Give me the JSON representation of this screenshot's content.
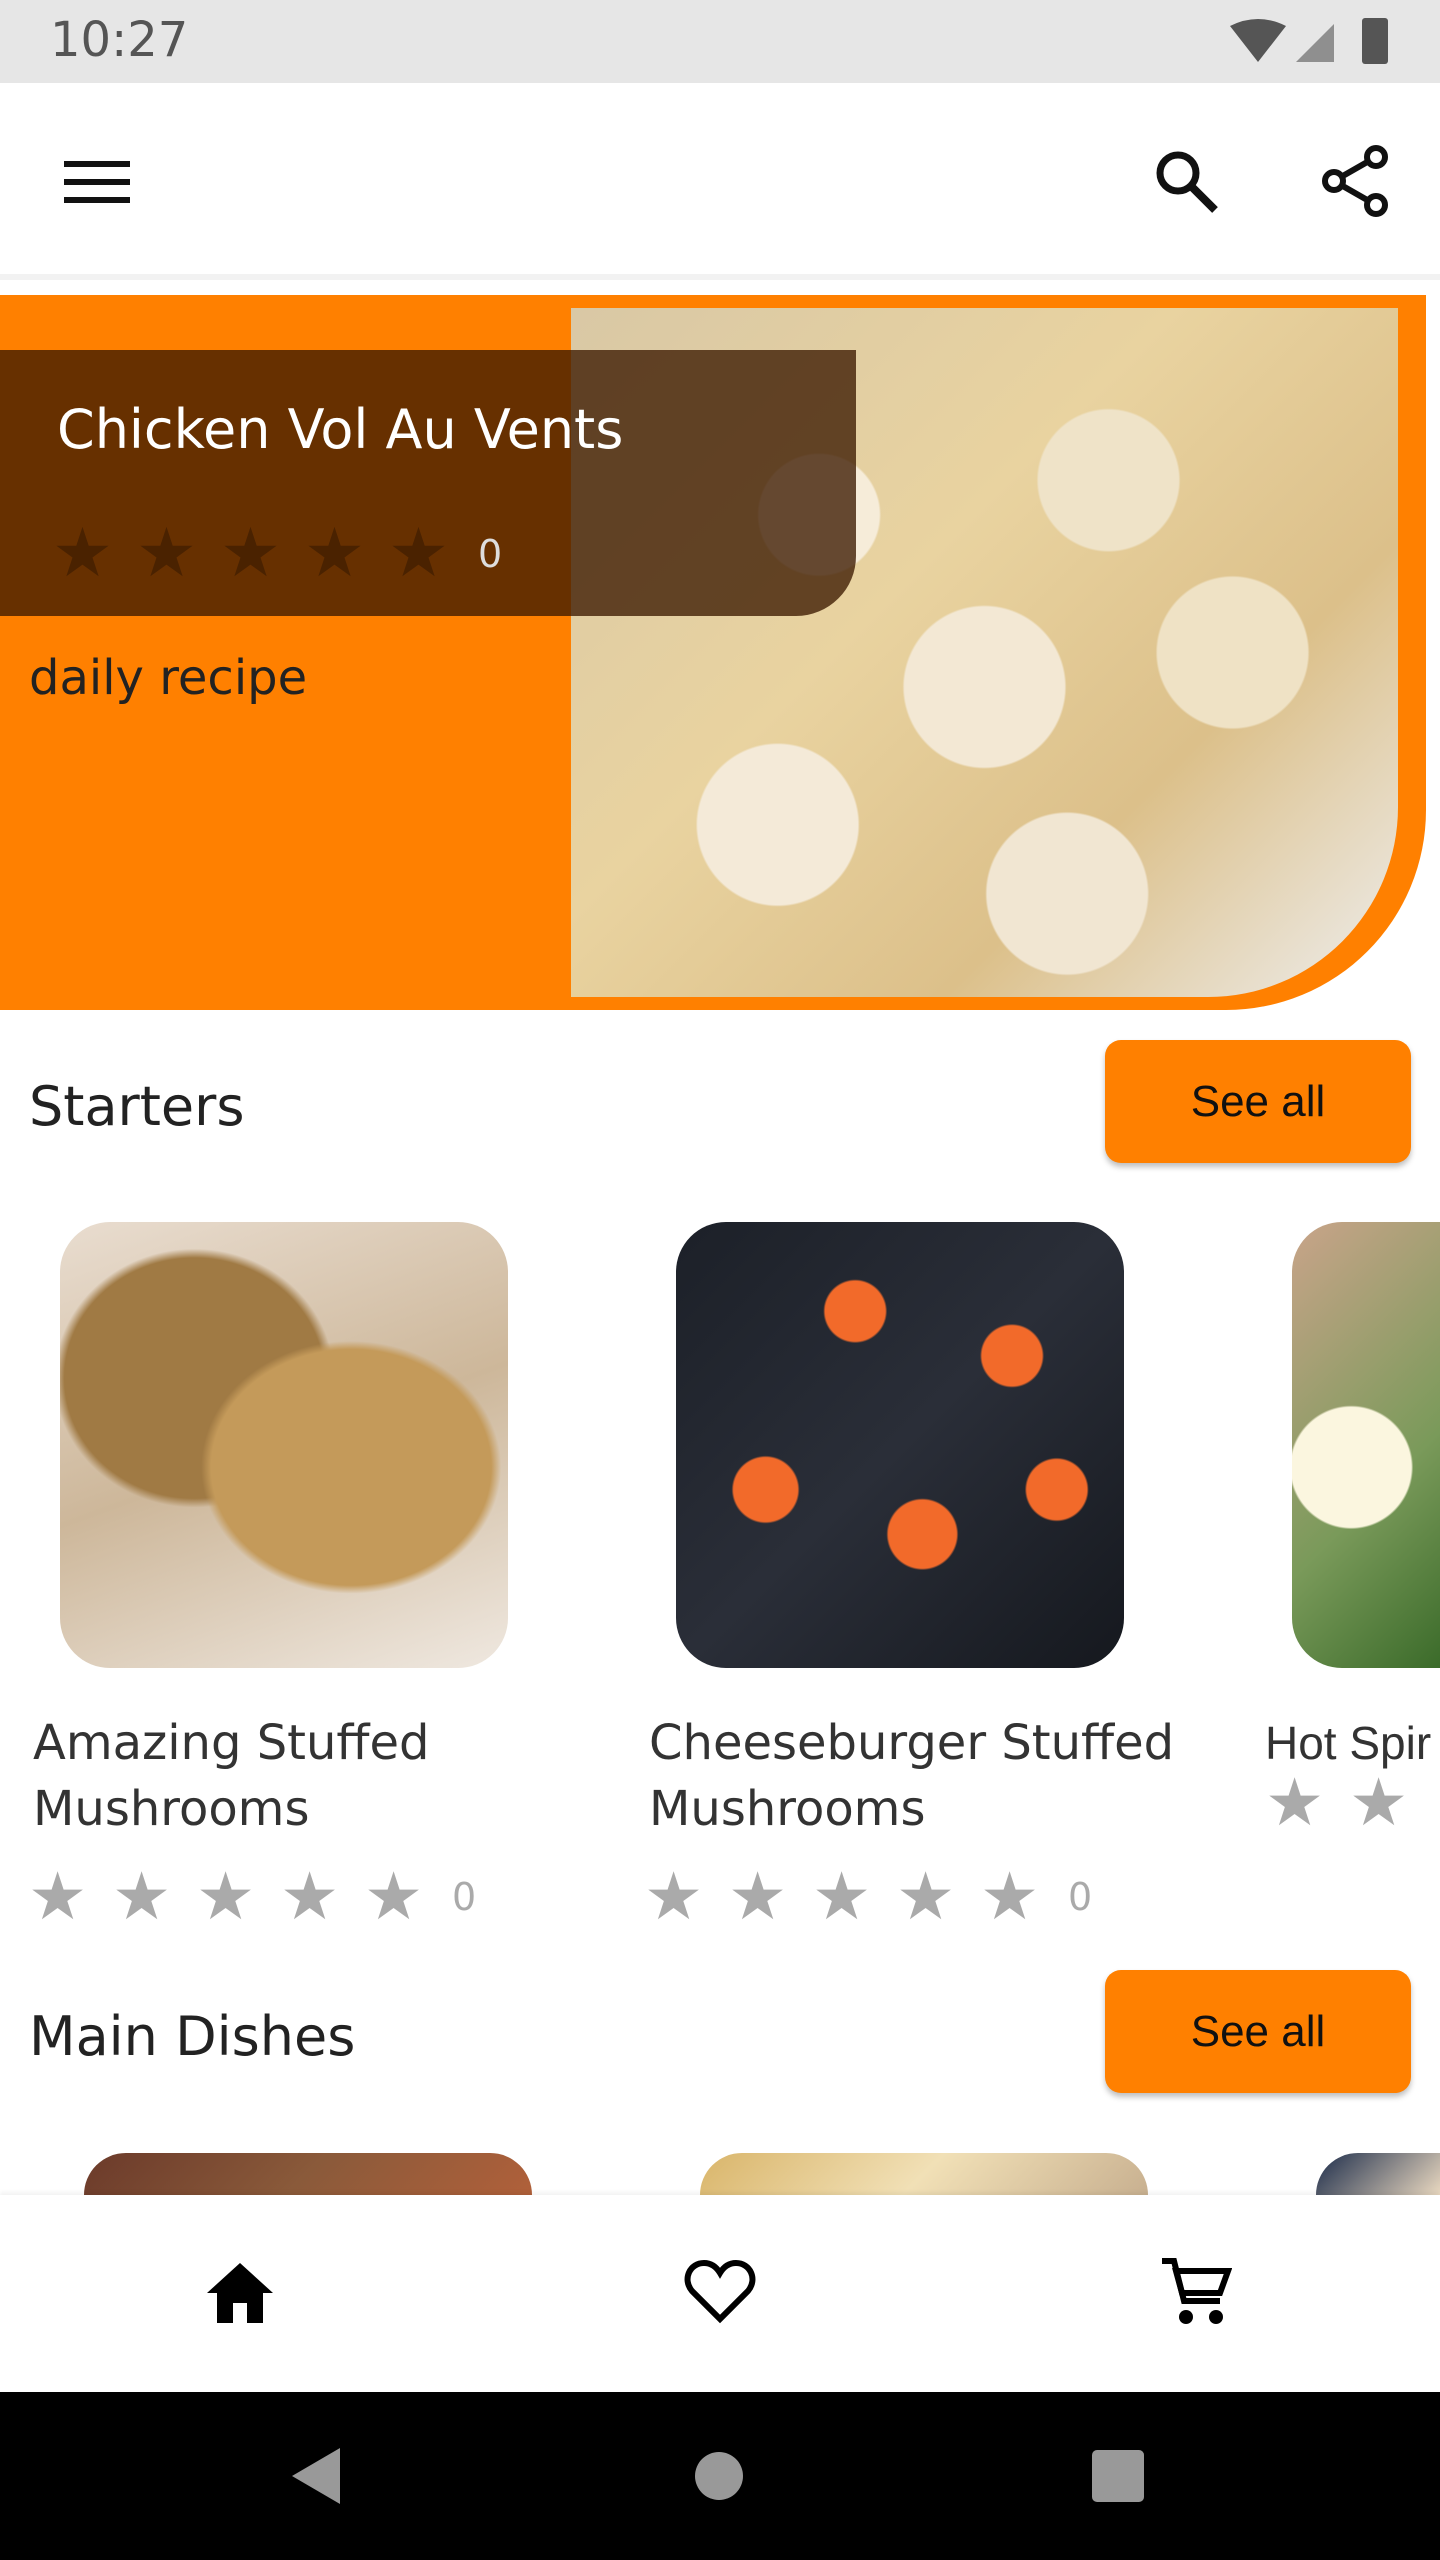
{
  "status_bar": {
    "time": "10:27",
    "icons": [
      "wifi-icon",
      "signal-icon",
      "battery-icon"
    ]
  },
  "app_bar": {
    "icons": [
      "menu-icon",
      "search-icon",
      "share-icon"
    ]
  },
  "hero": {
    "title": "Chicken Vol Au Vents",
    "rating_count": "0",
    "rating": 0,
    "subtitle": "daily recipe"
  },
  "sections": [
    {
      "title": "Starters",
      "see_all": "See all",
      "cards": [
        {
          "title": "Amazing Stuffed Mushrooms",
          "rating_count": "0",
          "rating": 0
        },
        {
          "title": "Cheeseburger Stuffed Mushrooms",
          "rating_count": "0",
          "rating": 0
        },
        {
          "title": "Hot Spir",
          "rating": 0
        }
      ]
    },
    {
      "title": "Main Dishes",
      "see_all": "See all"
    }
  ],
  "bottom_nav": {
    "items": [
      "home-icon",
      "heart-icon",
      "cart-icon"
    ]
  },
  "colors": {
    "accent": "#ff8000",
    "overlay": "#3c1900",
    "star_empty": "#aaaaaa"
  }
}
